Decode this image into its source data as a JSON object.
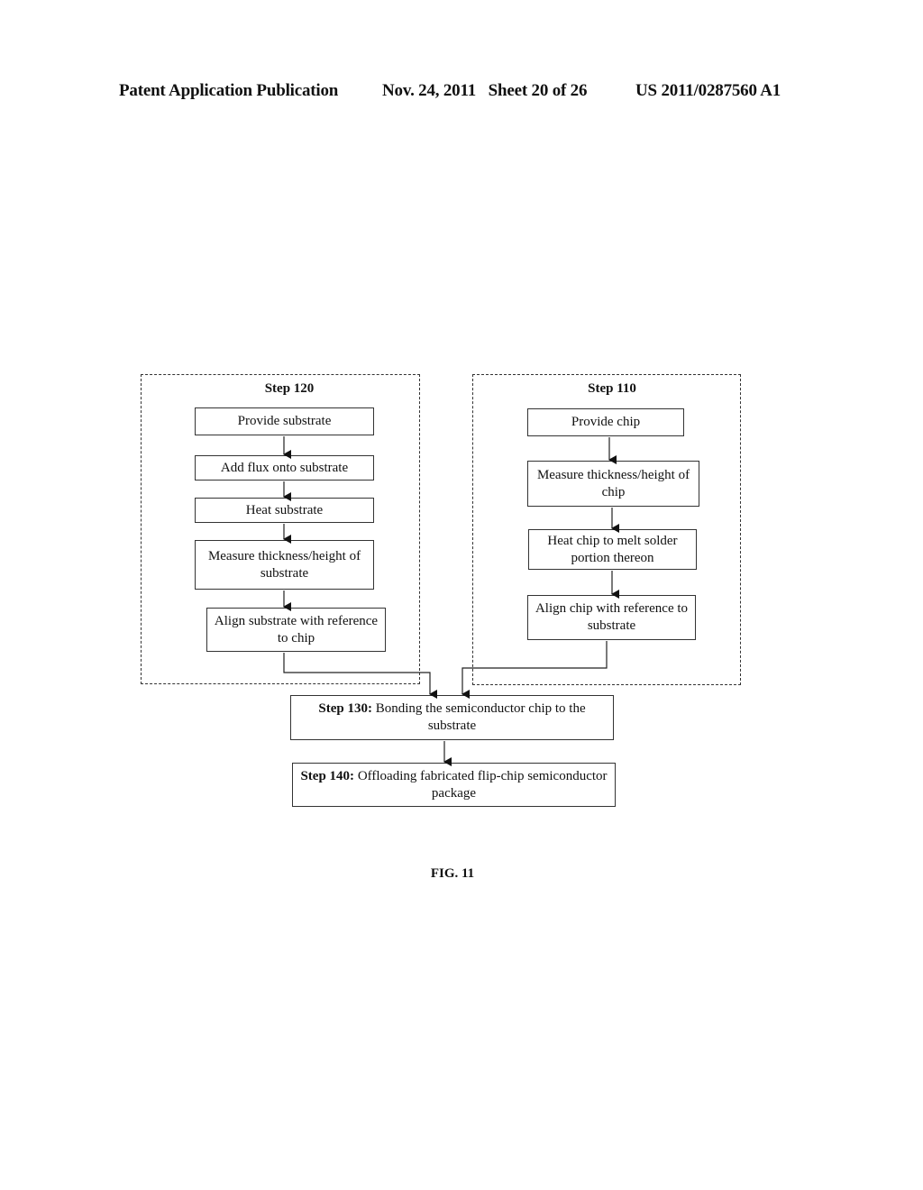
{
  "header": {
    "publication": "Patent Application Publication",
    "date_sheet": "Nov. 24, 2011   Sheet 20 of 26",
    "number": "US 2011/0287560 A1"
  },
  "diagram": {
    "group_substrate": {
      "title": "Step 120",
      "steps": [
        "Provide substrate",
        "Add flux onto substrate",
        "Heat substrate",
        "Measure thickness/height of substrate",
        "Align substrate with reference to chip"
      ]
    },
    "group_chip": {
      "title": "Step 110",
      "steps": [
        "Provide chip",
        "Measure thickness/height of chip",
        "Heat chip to melt solder portion thereon",
        "Align chip with reference to substrate"
      ]
    },
    "step130": {
      "label": "Step 130:",
      "text": " Bonding the semiconductor chip to the substrate"
    },
    "step140": {
      "label": "Step 140:",
      "text": " Offloading fabricated flip-chip semiconductor package"
    }
  },
  "figure_label": "FIG. 11"
}
